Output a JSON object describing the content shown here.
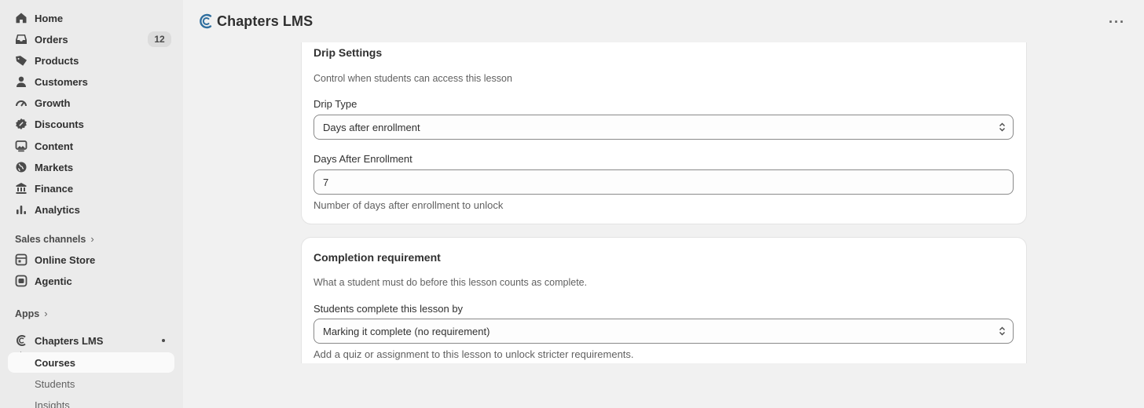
{
  "sidebar": {
    "items": [
      {
        "label": "Home",
        "icon": "home-icon"
      },
      {
        "label": "Orders",
        "icon": "inbox-icon",
        "badge": "12"
      },
      {
        "label": "Products",
        "icon": "tag-icon"
      },
      {
        "label": "Customers",
        "icon": "person-icon"
      },
      {
        "label": "Growth",
        "icon": "gauge-icon"
      },
      {
        "label": "Discounts",
        "icon": "discount-icon"
      },
      {
        "label": "Content",
        "icon": "image-icon"
      },
      {
        "label": "Markets",
        "icon": "globe-icon"
      },
      {
        "label": "Finance",
        "icon": "bank-icon"
      },
      {
        "label": "Analytics",
        "icon": "bar-chart-icon"
      }
    ],
    "sales_channels_label": "Sales channels",
    "channels": [
      {
        "label": "Online Store",
        "icon": "store-icon"
      },
      {
        "label": "Agentic",
        "icon": "agentic-icon"
      }
    ],
    "apps_label": "Apps",
    "app": {
      "label": "Chapters LMS",
      "icon": "chapters-logo-icon"
    },
    "app_sub": [
      {
        "label": "Courses"
      },
      {
        "label": "Students"
      },
      {
        "label": "Insights"
      }
    ]
  },
  "header": {
    "title": "Chapters LMS",
    "brand_color": "#2f6f9f"
  },
  "drip": {
    "title": "Drip Settings",
    "description": "Control when students can access this lesson",
    "type_label": "Drip Type",
    "type_value": "Days after enrollment",
    "days_label": "Days After Enrollment",
    "days_value": "7",
    "days_help": "Number of days after enrollment to unlock"
  },
  "completion": {
    "title": "Completion requirement",
    "description": "What a student must do before this lesson counts as complete.",
    "by_label": "Students complete this lesson by",
    "by_value": "Marking it complete (no requirement)",
    "help": "Add a quiz or assignment to this lesson to unlock stricter requirements."
  }
}
